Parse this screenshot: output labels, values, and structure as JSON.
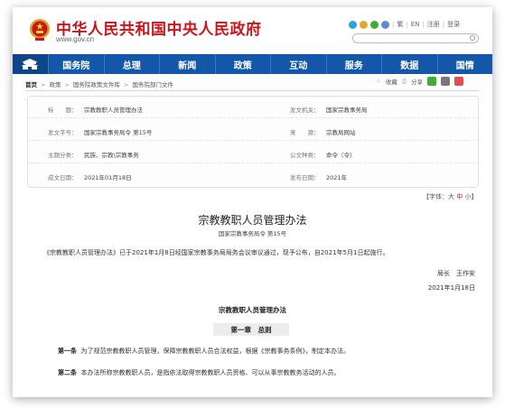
{
  "header": {
    "title": "中华人民共和国中央人民政府",
    "url": "www.gov.cn",
    "utility": [
      "繁",
      "EN",
      "注册",
      "登录"
    ]
  },
  "nav": {
    "items": [
      "国务院",
      "总理",
      "新闻",
      "政策",
      "互动",
      "服务",
      "数据",
      "国情"
    ]
  },
  "breadcrumb": [
    "首页",
    "政策",
    "国务院政策文件库",
    "国务院部门文件"
  ],
  "share": {
    "collect_label": "收藏",
    "share_label": "分享"
  },
  "info": {
    "title_label": "标　　题：",
    "title_value": "宗教教职人员管理办法",
    "issuer_label": "发文机关：",
    "issuer_value": "国家宗教事务局",
    "number_label": "发文字号：",
    "number_value": "国家宗教事务局令 第15号",
    "source_label": "来　　源：",
    "source_value": "宗教局网站",
    "topic_label": "主题分类：",
    "topic_value": "民族、宗教\\宗教事务",
    "type_label": "公文种类：",
    "type_value": "命令（令）",
    "date_label": "成文日期：",
    "date_value": "2021年01月18日",
    "pub_label": "发布日期：",
    "pub_value": "2021年"
  },
  "fontsize": {
    "prefix": "【字体：",
    "large": "大",
    "medium": "中",
    "small": "小",
    "suffix": "】"
  },
  "article": {
    "title": "宗教教职人员管理办法",
    "subtitle": "国家宗教事务局令 第15号",
    "intro": "《宗教教职人员管理办法》已于2021年1月8日经国家宗教事务局局务会议审议通过，现予公布，自2021年5月1日起施行。",
    "signer": "局长　王作安",
    "sign_date": "2021年1月18日",
    "body_title": "宗教教职人员管理办法",
    "chapter": "第一章　总则",
    "art1_label": "第一条",
    "art1_text": "为了规范宗教教职人员管理，保障宗教教职人员合法权益，根据《宗教事务条例》，制定本办法。",
    "art2_label": "第二条",
    "art2_text": "本办法所称宗教教职人员，是指依法取得宗教教职人员资格、可以从事宗教教务活动的人员。"
  },
  "colors": {
    "brand_red": "#c8161d",
    "nav_blue": "#1457a8"
  }
}
